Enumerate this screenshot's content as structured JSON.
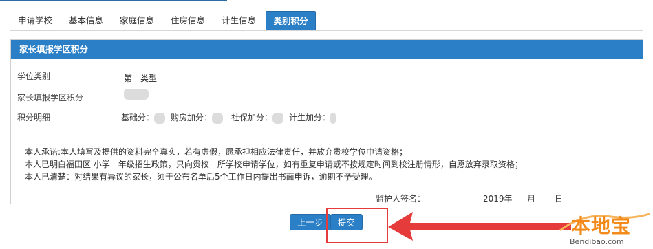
{
  "tabs": [
    {
      "label": "申请学校"
    },
    {
      "label": "基本信息"
    },
    {
      "label": "家庭信息"
    },
    {
      "label": "住房信息"
    },
    {
      "label": "计生信息"
    },
    {
      "label": "类别积分",
      "active": true
    }
  ],
  "panel": {
    "header": "家长填报学区积分",
    "rows": {
      "category_label": "学位类别",
      "category_value": "第一类型",
      "score_label": "家长填报学区积分",
      "detail_label": "积分明细"
    },
    "score_items": {
      "base": "基础分：",
      "housing": "购房加分：",
      "social": "社保加分：",
      "family_planning": "计生加分："
    },
    "promise_lines": [
      "本人承诺:本人填写及提供的资料完全真实，若有虚假，愿承担相应法律责任，并放弃贵校学位申请资格；",
      "本人已明白福田区 小学一年级招生政策，只向贵校一所学校申请学位，如有重复申请或不按规定时间到校注册情形，自愿放弃录取资格；",
      "本人已清楚：对结果有异议的家长，须于公布名单后5个工作日内提出书面申诉，逾期不予受理。"
    ],
    "sign": {
      "label": "监护人签名：",
      "year": "2019年",
      "month": "月",
      "day": "日"
    }
  },
  "buttons": {
    "prev": "上一步",
    "submit": "提交"
  },
  "watermark": {
    "name": "本地宝",
    "url": "Bendibao.com"
  },
  "colors": {
    "primary": "#2b7fc6",
    "highlight": "#e53b3b",
    "logo": "#f28b1b"
  }
}
